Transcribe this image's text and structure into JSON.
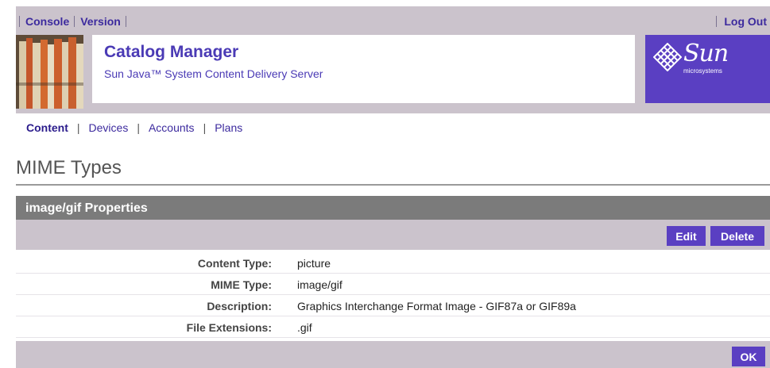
{
  "masthead": {
    "console": "Console",
    "version": "Version",
    "logout": "Log Out",
    "app_title": "Catalog Manager",
    "app_subtitle": "Sun Java™ System Content Delivery Server",
    "logo_word": "Sun",
    "logo_small": "microsystems",
    "logo_color": "#5a3fc2"
  },
  "tabs": [
    {
      "label": "Content",
      "active": true
    },
    {
      "label": "Devices",
      "active": false
    },
    {
      "label": "Accounts",
      "active": false
    },
    {
      "label": "Plans",
      "active": false
    }
  ],
  "page": {
    "title": "MIME Types"
  },
  "panel": {
    "title": "image/gif Properties",
    "edit_label": "Edit",
    "delete_label": "Delete",
    "ok_label": "OK",
    "rows": [
      {
        "label": "Content Type:",
        "value": "picture"
      },
      {
        "label": "MIME Type:",
        "value": "image/gif"
      },
      {
        "label": "Description:",
        "value": "Graphics Interchange Format Image - GIF87a or GIF89a"
      },
      {
        "label": "File Extensions:",
        "value": ".gif"
      }
    ]
  }
}
